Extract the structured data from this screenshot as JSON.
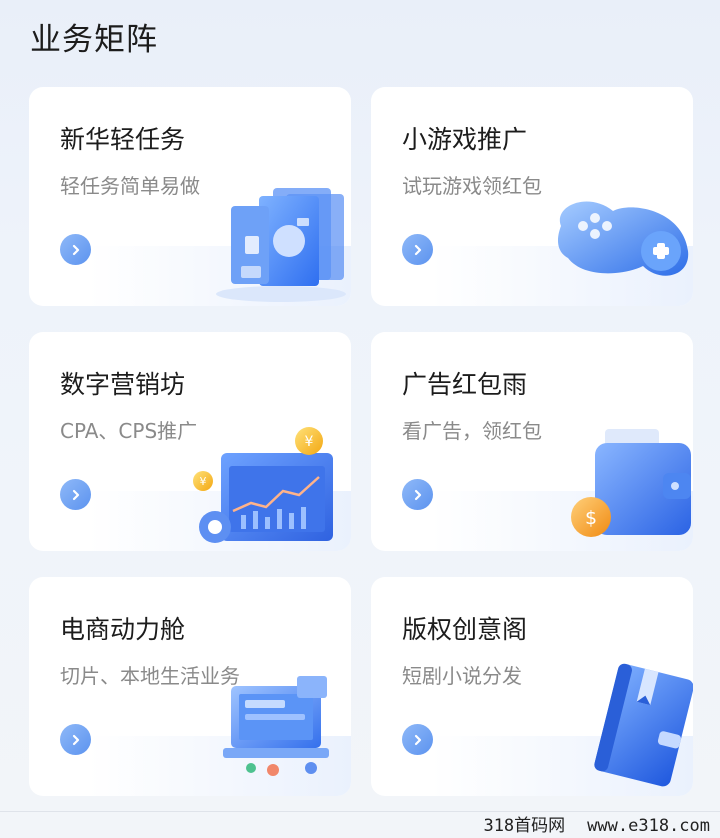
{
  "page": {
    "title": "业务矩阵"
  },
  "cards": [
    {
      "title": "新华轻任务",
      "subtitle": "轻任务简单易做",
      "icon": "task-screens-icon"
    },
    {
      "title": "小游戏推广",
      "subtitle": "试玩游戏领红包",
      "icon": "gamepad-icon"
    },
    {
      "title": "数字营销坊",
      "subtitle": "CPA、CPS推广",
      "icon": "chart-coins-icon"
    },
    {
      "title": "广告红包雨",
      "subtitle": "看广告，领红包",
      "icon": "wallet-coin-icon"
    },
    {
      "title": "电商动力舱",
      "subtitle": "切片、本地生活业务",
      "icon": "laptop-icon"
    },
    {
      "title": "版权创意阁",
      "subtitle": "短剧小说分发",
      "icon": "book-icon"
    }
  ],
  "watermark": {
    "site_name": "318首码网",
    "url": "www.e318.com"
  },
  "colors": {
    "accent": "#5c93ef",
    "card_bg": "#ffffff",
    "page_bg": "#eef3fa"
  }
}
